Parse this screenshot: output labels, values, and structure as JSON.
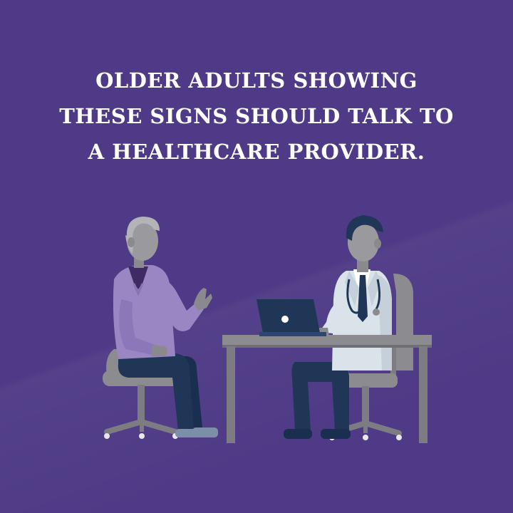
{
  "headline": {
    "line1": "OLDER ADULTS SHOWING",
    "line2": "THESE SIGNS SHOULD TALK TO",
    "line3": "A HEALTHCARE PROVIDER."
  },
  "colors": {
    "background": "#4e3a86",
    "text": "#ffffff",
    "furniture": "#8b8b90",
    "patient_sweater": "#9b86c4",
    "pants": "#1f3657",
    "doctor_coat": "#dbe3ea",
    "laptop": "#1f3657"
  }
}
